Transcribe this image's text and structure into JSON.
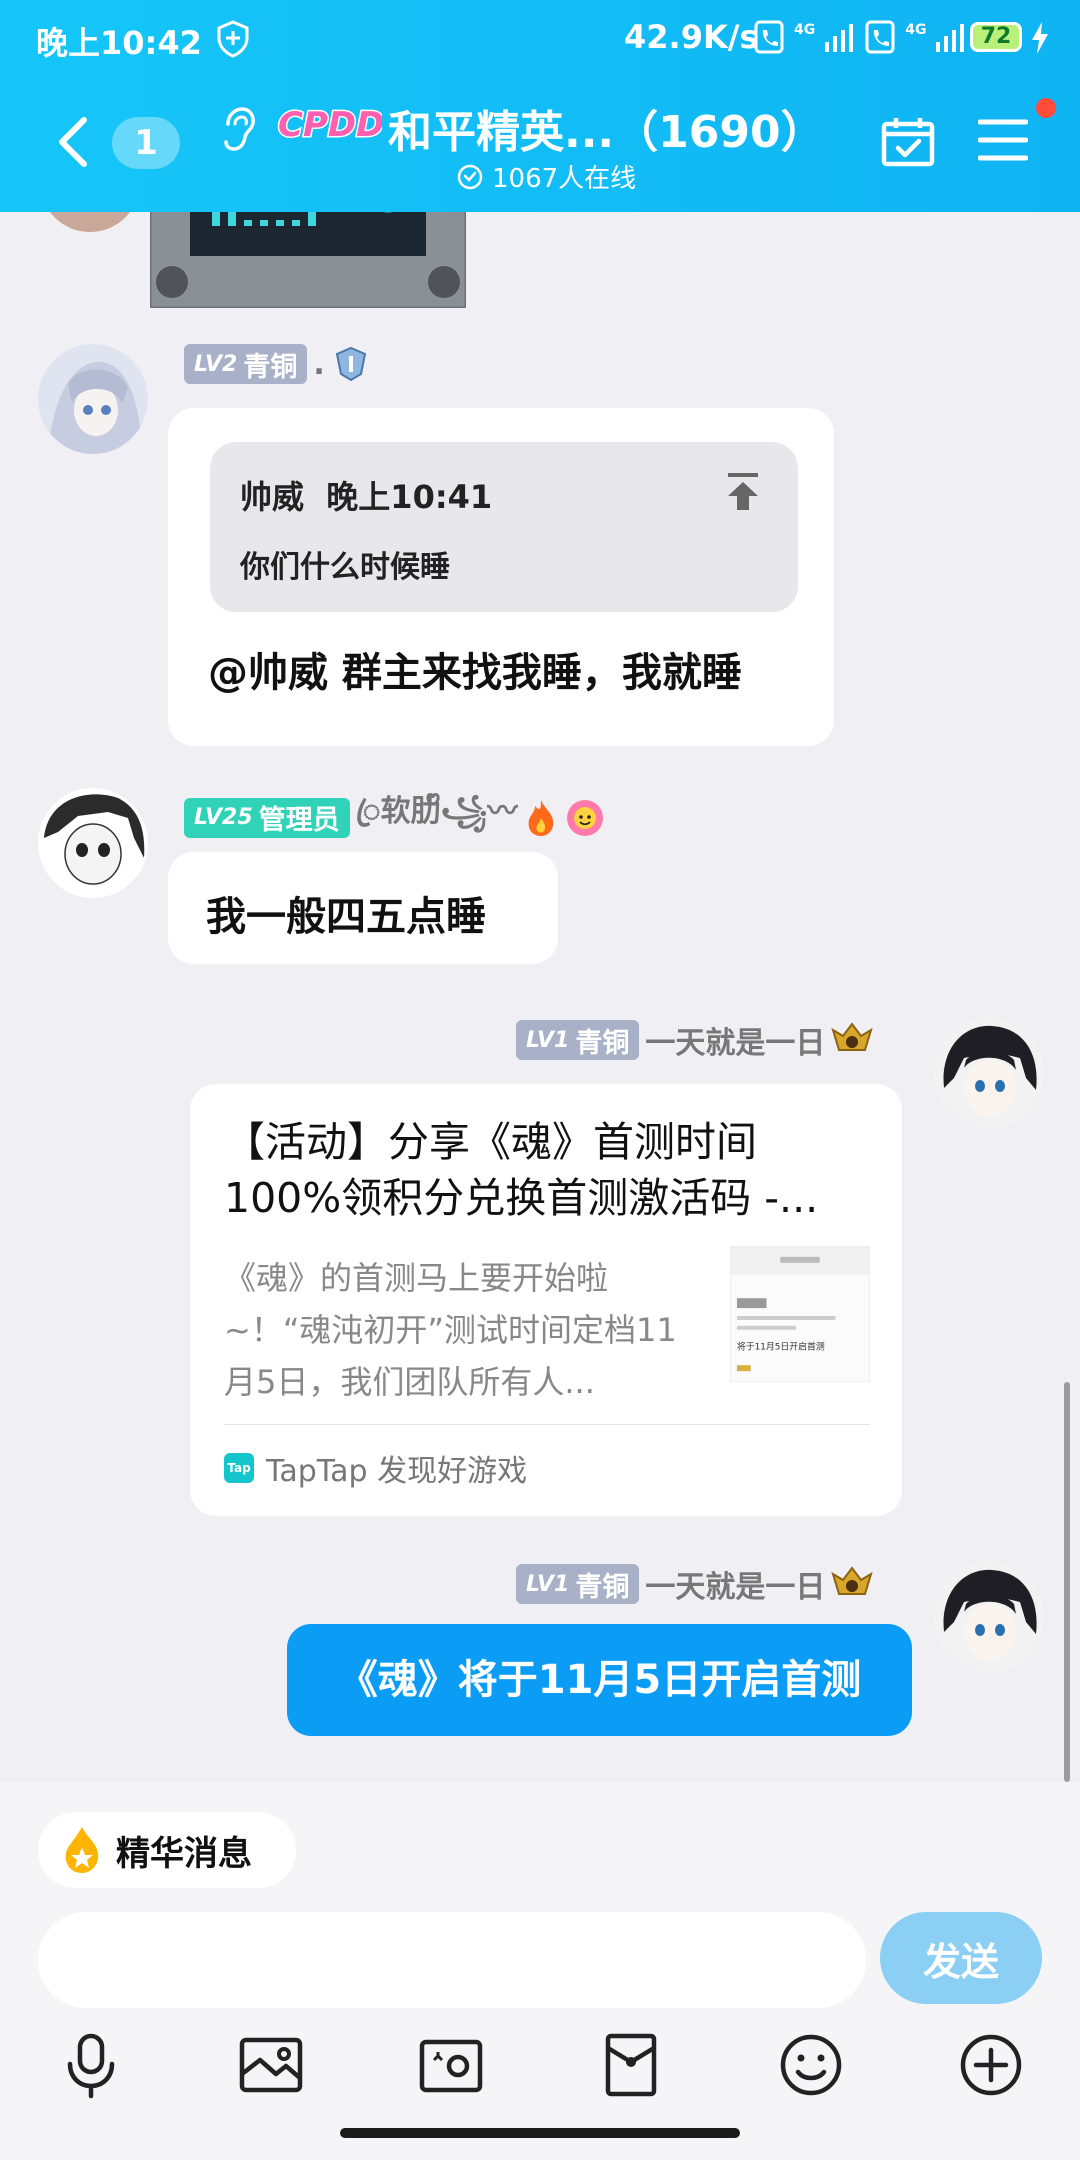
{
  "status_bar": {
    "time": "晚上10:42",
    "net_speed": "42.9K/s",
    "network_1": "4G",
    "network_2": "4G",
    "battery": "72"
  },
  "header": {
    "unread_count": "1",
    "logo_text": "CPDD",
    "group_name": "和平精英...（1690）",
    "online_text": "1067人在线"
  },
  "messages": [
    {
      "level": "LV2",
      "level_title": "青铜",
      "nick": ".",
      "quote_author": "帅威",
      "quote_time": "晚上10:41",
      "quote_text": "你们什么时候睡",
      "text": "@帅威 群主来找我睡，我就睡"
    },
    {
      "level": "LV25",
      "level_title": "管理员",
      "nick": "ꦿ软肋ᩚ꧁〰",
      "text": "我一般四五点睡"
    },
    {
      "level": "LV1",
      "level_title": "青铜",
      "nick": "一天就是一日",
      "card_title": "【活动】分享《魂》首测时间100%领积分兑换首测激活码 -...",
      "card_desc": "《魂》的首测马上要开始啦~！“魂沌初开”测试时间定档11月5日，我们团队所有人...",
      "card_source": "TapTap 发现好游戏",
      "card_thumb_text": "将于11月5日开启首测"
    },
    {
      "level": "LV1",
      "level_title": "青铜",
      "nick": "一天就是一日",
      "text": "《魂》将于11月5日开启首测"
    }
  ],
  "composer": {
    "essence_label": "精华消息",
    "input_placeholder": "",
    "send_label": "发送"
  },
  "toolbar_icons": [
    "microphone-icon",
    "image-icon",
    "camera-icon",
    "red-packet-icon",
    "emoji-icon",
    "plus-icon"
  ],
  "colors": {
    "header_bg": "#16c6f8",
    "bubble_blue": "#0b9cf5",
    "send_button": "#8ccff5",
    "admin_badge": "#30d3b8",
    "bronze_badge": "#a9b1c8"
  }
}
